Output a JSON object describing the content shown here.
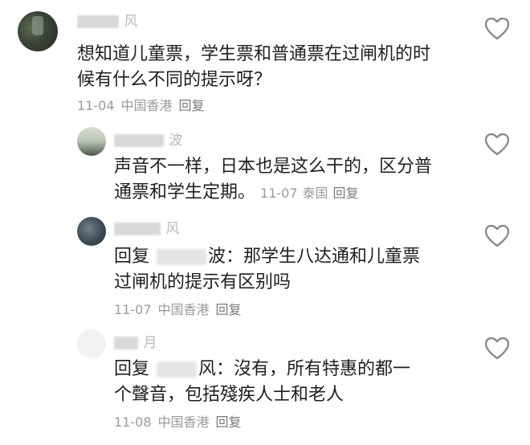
{
  "comments": [
    {
      "username": "风",
      "text_line1": "想知道儿童票，学生票和普通票在过闸机的时",
      "text_line2": "候有什么不同的提示呀？",
      "date": "11-04",
      "location": "中国香港",
      "reply_label": "回复"
    },
    {
      "username": "波",
      "text_line1": "声音不一样，日本也是这么干的，区分普",
      "text_line2": "通票和学生定期。",
      "date": "11-07",
      "location": "泰国",
      "reply_label": "回复"
    },
    {
      "username": "风",
      "reply_prefix": "回复",
      "mention": "波：",
      "text_line1": "那学生八达通和儿童票",
      "text_line2": "过闸机的提示有区别吗",
      "date": "11-07",
      "location": "中国香港",
      "reply_label": "回复"
    },
    {
      "username": "月",
      "reply_prefix": "回复",
      "mention": "风：",
      "text_line1": "沒有，所有特惠的都一",
      "text_line2": "个聲音，包括殘疾人士和老人",
      "date": "11-08",
      "location": "中国香港",
      "reply_label": "回复"
    }
  ],
  "icons": {
    "like": "heart-outline-icon"
  },
  "colors": {
    "text": "#1f1f1f",
    "meta": "#9a9a9a",
    "icon": "#8a8a8a"
  }
}
